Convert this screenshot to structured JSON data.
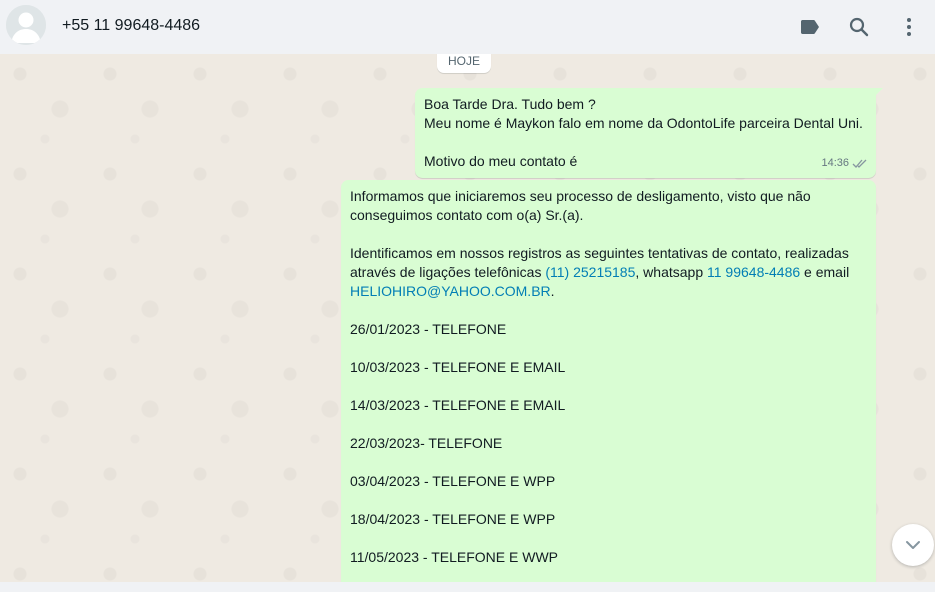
{
  "header": {
    "contact_name": "+55 11 99648-4486",
    "icons": [
      "label-icon",
      "search-icon",
      "more-options-icon"
    ]
  },
  "chat": {
    "day_divider": "HOJE",
    "messages": [
      {
        "lines": [
          "Boa Tarde Dra. Tudo bem ?",
          "Meu nome é Maykon falo em nome da OdontoLife parceira Dental Uni.",
          "",
          "Motivo do meu contato é"
        ],
        "time": "14:36",
        "status": "delivered"
      },
      {
        "para1": [
          "Informamos que iniciaremos seu processo de desligamento, visto que não",
          "conseguimos contato com o(a) Sr.(a)."
        ],
        "para2_line1": "Identificamos em nossos registros as seguintes tentativas de contato, realizadas",
        "para2_line2_prefix": "através de ligações telefônicas ",
        "phone_link": "(11) 25215185",
        "para2_line2_mid": ", whatsapp ",
        "whatsapp_link": "11 99648-4486",
        "para2_line2_suffix": " e email",
        "email_link": "HELIOHIRO@YAHOO.COM.BR",
        "para2_line3_suffix": ".",
        "attempts": [
          "26/01/2023 - TELEFONE",
          "10/03/2023 - TELEFONE E EMAIL",
          "14/03/2023 - TELEFONE E EMAIL",
          "22/03/2023- TELEFONE",
          "03/04/2023 - TELEFONE E WPP",
          "18/04/2023 - TELEFONE E WPP",
          "11/05/2023 - TELEFONE E WWP"
        ]
      }
    ]
  }
}
